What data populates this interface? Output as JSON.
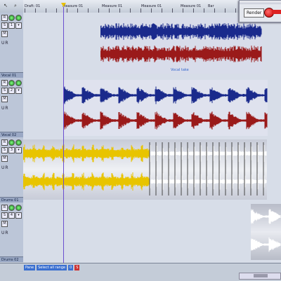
{
  "ruler": {
    "labels": [
      "Draft: 01",
      "Measure 01",
      "Measure 01",
      "Measure 01",
      "Measure 01",
      "Bar"
    ],
    "tick_count": 24
  },
  "overlay": {
    "button_label": "Render",
    "record_color": "#cc0000"
  },
  "tracks": [
    {
      "number": "1",
      "label": "Vocal 01",
      "region_name": "Vocal take",
      "wave_colors": [
        "#1a2a8c",
        "#9a1a1a"
      ]
    },
    {
      "number": "2",
      "label": "Vocal 02",
      "region_name": "",
      "wave_colors": [
        "#1a2a8c",
        "#9a1a1a"
      ]
    },
    {
      "number": "3",
      "label": "Drums 01",
      "region_name": "",
      "wave_colors": [
        "#e8c400",
        "#ffffff"
      ]
    },
    {
      "number": "4",
      "label": "Drums 02",
      "region_name": "",
      "wave_colors": [
        "#ffffff",
        "#ffffff"
      ]
    }
  ],
  "track_controls": {
    "record_symbol": "R",
    "mute_symbol": "M",
    "solo_symbol": "S",
    "u_label": "U",
    "r_label": "R"
  },
  "status": {
    "mode": "Pane",
    "message": "Select all range",
    "counter": "0",
    "flag": "S"
  },
  "icons": [
    "record-icon",
    "mute-icon",
    "solo-icon",
    "cursor-icon",
    "zoom-icon"
  ]
}
